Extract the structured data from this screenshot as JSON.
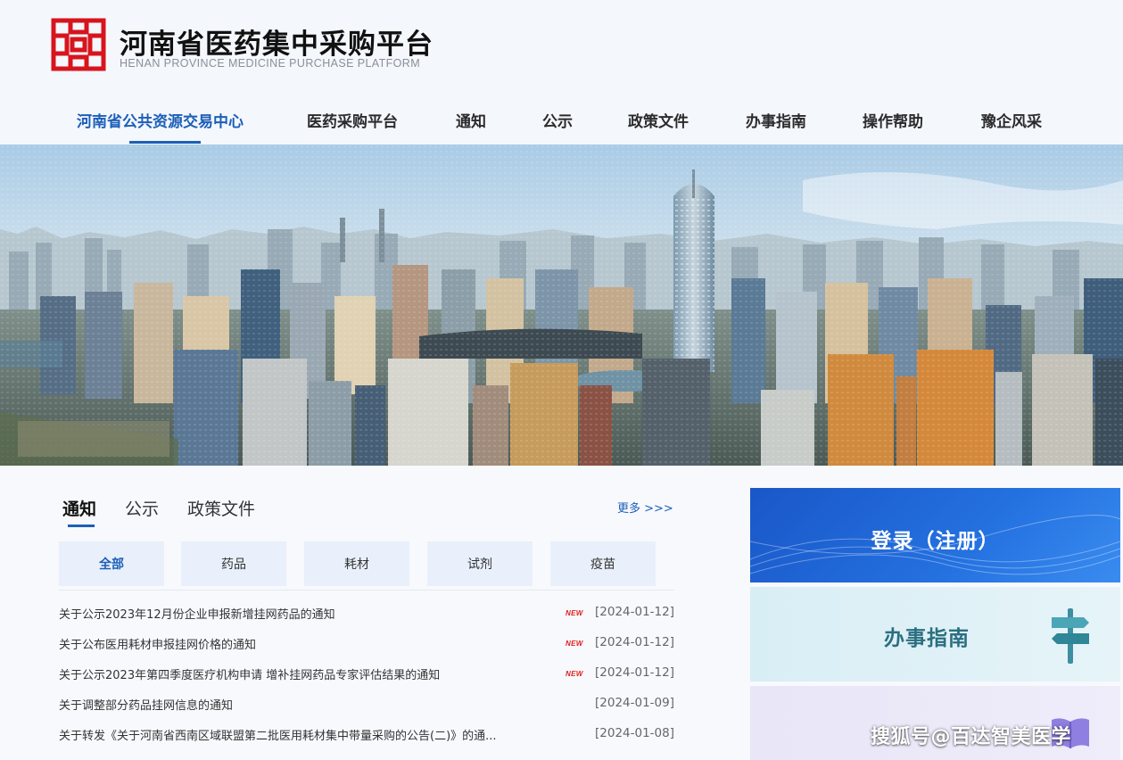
{
  "header": {
    "title": "河南省医药集中采购平台",
    "subtitle": "HENAN PROVINCE MEDICINE PURCHASE PLATFORM"
  },
  "nav": {
    "items": [
      {
        "label": "河南省公共资源交易中心",
        "active": true
      },
      {
        "label": "医药采购平台",
        "active": false
      },
      {
        "label": "通知",
        "active": false
      },
      {
        "label": "公示",
        "active": false
      },
      {
        "label": "政策文件",
        "active": false
      },
      {
        "label": "办事指南",
        "active": false
      },
      {
        "label": "操作帮助",
        "active": false
      },
      {
        "label": "豫企风采",
        "active": false
      }
    ]
  },
  "content": {
    "tabs": [
      {
        "label": "通知",
        "active": true
      },
      {
        "label": "公示",
        "active": false
      },
      {
        "label": "政策文件",
        "active": false
      }
    ],
    "more": "更多 >>>",
    "filters": [
      {
        "label": "全部",
        "active": true
      },
      {
        "label": "药品",
        "active": false
      },
      {
        "label": "耗材",
        "active": false
      },
      {
        "label": "试剂",
        "active": false
      },
      {
        "label": "疫苗",
        "active": false
      }
    ],
    "new_badge": "NEW",
    "notices": [
      {
        "title": "关于公示2023年12月份企业申报新增挂网药品的通知",
        "date": "[2024-01-12]",
        "is_new": true
      },
      {
        "title": "关于公布医用耗材申报挂网价格的通知",
        "date": "[2024-01-12]",
        "is_new": true
      },
      {
        "title": "关于公示2023年第四季度医疗机构申请 增补挂网药品专家评估结果的通知",
        "date": "[2024-01-12]",
        "is_new": true
      },
      {
        "title": "关于调整部分药品挂网信息的通知",
        "date": "[2024-01-09]",
        "is_new": false
      },
      {
        "title": "关于转发《关于河南省西南区域联盟第二批医用耗材集中带量采购的公告(二)》的通...",
        "date": "[2024-01-08]",
        "is_new": false
      }
    ]
  },
  "side": {
    "login_label": "登录（注册）",
    "guide_label": "办事指南"
  },
  "watermark": "搜狐号@百达智美医学",
  "colors": {
    "accent": "#1c5fb8",
    "logo_red": "#d8141c",
    "new_badge": "#e02020"
  }
}
